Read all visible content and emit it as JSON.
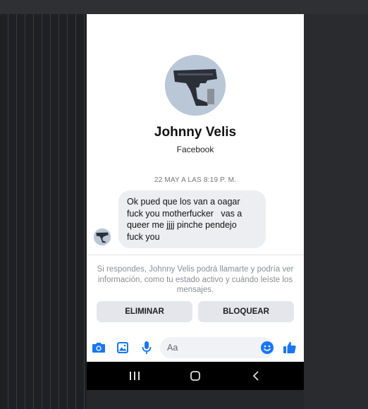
{
  "profile": {
    "name": "Johnny Velis",
    "source": "Facebook"
  },
  "conversation": {
    "timestamp": "22 MAY A LAS 8:19 P. M.",
    "message": "Ok pued que los van a oagar\nfuck you motherfucker   vas a\nqueer me jjjj pinche pendejo\nfuck you"
  },
  "notice": {
    "text": "Si respondes, Johnny Velis podrá llamarte y podría ver información, como tu estado activo y cuándo leíste los mensajes."
  },
  "actions": {
    "delete_label": "ELIMINAR",
    "block_label": "BLOQUEAR"
  },
  "composer": {
    "placeholder": "Aa"
  },
  "colors": {
    "accent": "#1877f2",
    "bubble": "#eceef1",
    "button_bg": "#e4e6eb"
  },
  "icons": [
    "gun-avatar-icon",
    "camera-icon",
    "gallery-icon",
    "microphone-icon",
    "emoji-icon",
    "thumbs-up-icon",
    "recent-apps-icon",
    "home-icon",
    "back-icon"
  ]
}
